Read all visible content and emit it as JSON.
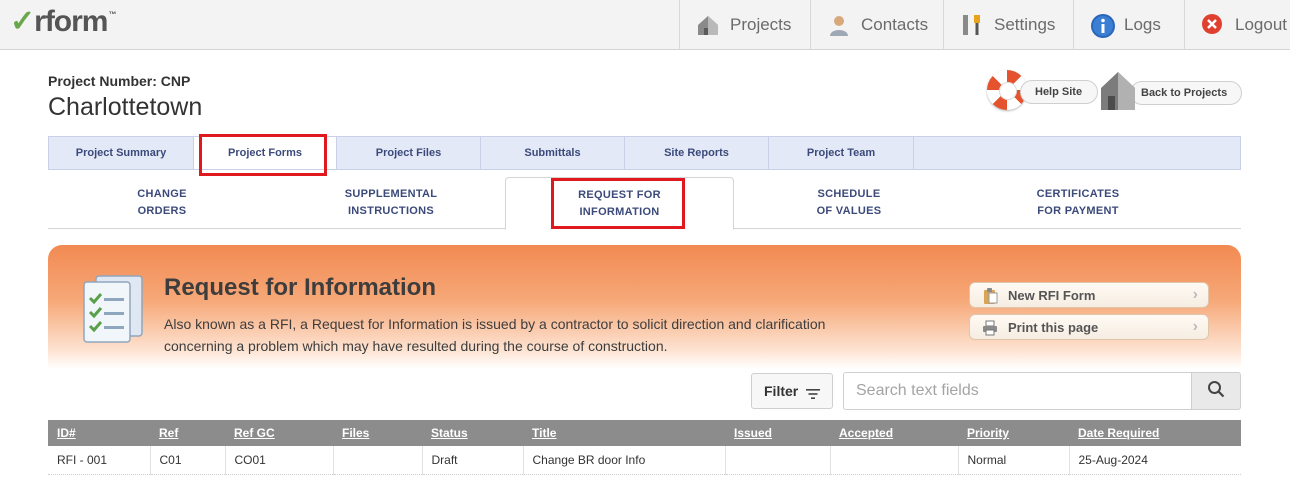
{
  "app": {
    "logo_text": "rform",
    "logo_check": "✓",
    "logo_tm": "™"
  },
  "topnav": [
    {
      "label": "Projects",
      "icon": "house-icon"
    },
    {
      "label": "Contacts",
      "icon": "person-icon"
    },
    {
      "label": "Settings",
      "icon": "tools-icon"
    },
    {
      "label": "Logs",
      "icon": "info-icon"
    },
    {
      "label": "Logout",
      "icon": "close-circle-icon"
    }
  ],
  "project": {
    "number_label": "Project Number: CNP",
    "name": "Charlottetown"
  },
  "header_links": {
    "help": "Help Site",
    "back": "Back to Projects"
  },
  "tabs": [
    "Project Summary",
    "Project Forms",
    "Project Files",
    "Submittals",
    "Site Reports",
    "Project Team"
  ],
  "active_tab": "Project Forms",
  "subtabs": [
    {
      "line1": "CHANGE",
      "line2": "ORDERS"
    },
    {
      "line1": "SUPPLEMENTAL",
      "line2": "INSTRUCTIONS"
    },
    {
      "line1": "REQUEST FOR",
      "line2": "INFORMATION"
    },
    {
      "line1": "SCHEDULE",
      "line2": "OF VALUES"
    },
    {
      "line1": "CERTIFICATES",
      "line2": "FOR PAYMENT"
    }
  ],
  "active_subtab": "REQUEST FOR INFORMATION",
  "banner": {
    "title": "Request for Information",
    "description": "Also known as a RFI, a Request for Information is issued by a contractor to solicit direction and clarification concerning a problem which may have resulted during the course of construction.",
    "new_button": "New RFI Form",
    "print_button": "Print this page"
  },
  "filter": {
    "label": "Filter",
    "search_placeholder": "Search text fields"
  },
  "table": {
    "columns": [
      "ID#",
      "Ref",
      "Ref GC",
      "Files",
      "Status",
      "Title",
      "Issued",
      "Accepted",
      "Priority",
      "Date Required"
    ],
    "rows": [
      [
        "RFI - 001",
        "C01",
        "CO01",
        "",
        "Draft",
        "Change BR door Info",
        "",
        "",
        "Normal",
        "25-Aug-2024"
      ]
    ]
  },
  "colors": {
    "highlight_red": "#e0191e",
    "banner_orange": "#f28a52",
    "tab_bg": "#e4e9f7",
    "header_gray": "#8c8c8c"
  }
}
